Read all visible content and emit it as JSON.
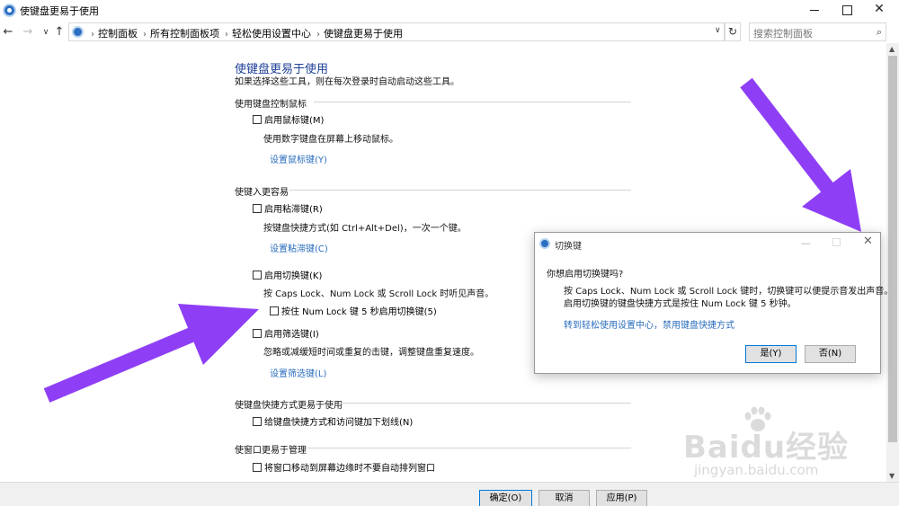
{
  "window": {
    "title": "使键盘更易于使用"
  },
  "nav": {
    "back": "←",
    "forward": "→",
    "recent": "∨",
    "up": "↑",
    "breadcrumbs": [
      "控制面板",
      "所有控制面板项",
      "轻松使用设置中心",
      "使键盘更易于使用"
    ],
    "refresh": "↻",
    "search_placeholder": "搜索控制面板"
  },
  "main": {
    "title": "使键盘更易于使用",
    "subtitle": "如果选择这些工具，则在每次登录时自动启动这些工具。",
    "section_mouse": {
      "heading": "使用键盘控制鼠标",
      "mouse_keys_label": "启用鼠标键(M)",
      "mouse_keys_desc": "使用数字键盘在屏幕上移动鼠标。",
      "mouse_keys_link": "设置鼠标键(Y)"
    },
    "section_typing": {
      "heading": "使键入更容易",
      "sticky_label": "启用粘滞键(R)",
      "sticky_desc": "按键盘快捷方式(如 Ctrl+Alt+Del)，一次一个键。",
      "sticky_link": "设置粘滞键(C)",
      "toggle_label": "启用切换键(K)",
      "toggle_desc": "按 Caps Lock、Num Lock 或 Scroll Lock 时听见声音。",
      "toggle_numlock_label": "按住 Num Lock 键 5 秒启用切换键(5)",
      "filter_label": "启用筛选键(I)",
      "filter_desc": "忽略或减缓短时间或重复的击键，调整键盘重复速度。",
      "filter_link": "设置筛选键(L)"
    },
    "section_shortcuts": {
      "heading": "使键盘快捷方式更易于使用",
      "underline_label": "给键盘快捷方式和访问键加下划线(N)"
    },
    "section_windows": {
      "heading": "使窗口更易于管理",
      "snap_label": "将窗口移动到屏幕边缘时不要自动排列窗口"
    }
  },
  "footer": {
    "ok": "确定(O)",
    "cancel": "取消",
    "apply": "应用(P)"
  },
  "dialog": {
    "title": "切换键",
    "question": "你想启用切换键吗?",
    "line1": "按 Caps Lock、Num Lock 或 Scroll Lock 键时，切换键可以便提示音发出声音。",
    "line2": "启用切换键的键盘快捷方式是按住 Num Lock 键 5 秒钟。",
    "link": "转到轻松使用设置中心，禁用键盘快捷方式",
    "yes": "是(Y)",
    "no": "否(N)"
  },
  "watermark": {
    "main": "Baidu经验",
    "sub": "jingyan.baidu.com"
  },
  "colors": {
    "arrow": "#8e3ff5",
    "link": "#2a6dbd",
    "title_blue": "#1e3f97"
  }
}
